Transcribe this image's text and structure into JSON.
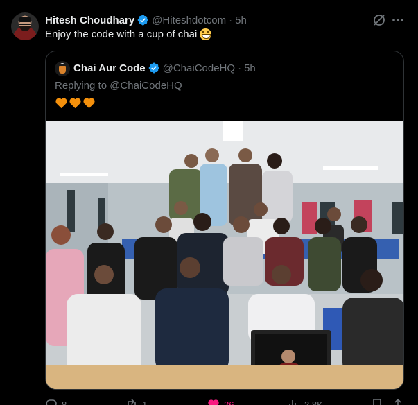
{
  "tweet": {
    "author_name": "Hitesh Choudhary",
    "author_handle": "@Hiteshdotcom",
    "separator": "·",
    "time": "5h",
    "text": "Enjoy the code with a cup of chai"
  },
  "quoted": {
    "author_name": "Chai Aur Code",
    "author_handle": "@ChaiCodeHQ",
    "separator": "·",
    "time": "5h",
    "replying_prefix": "Replying to",
    "replying_to": "@ChaiCodeHQ",
    "hearts_count": 3,
    "heart_color": "#f4900c",
    "photo_description_icon": "group-photo"
  },
  "actions": {
    "replies": "8",
    "reposts": "1",
    "likes": "26",
    "views": "2.8K"
  },
  "colors": {
    "background": "#000000",
    "text": "#e7e9ea",
    "muted": "#71767b",
    "verified": "#1d9bf0",
    "like": "#f91880",
    "border": "#2f3336"
  },
  "icons": {
    "verified": "verified-badge-icon",
    "grok": "grok-icon",
    "more": "more-icon",
    "reply": "reply-icon",
    "repost": "repost-icon",
    "like": "heart-icon",
    "views": "views-icon",
    "bookmark": "bookmark-icon",
    "share": "share-icon"
  }
}
